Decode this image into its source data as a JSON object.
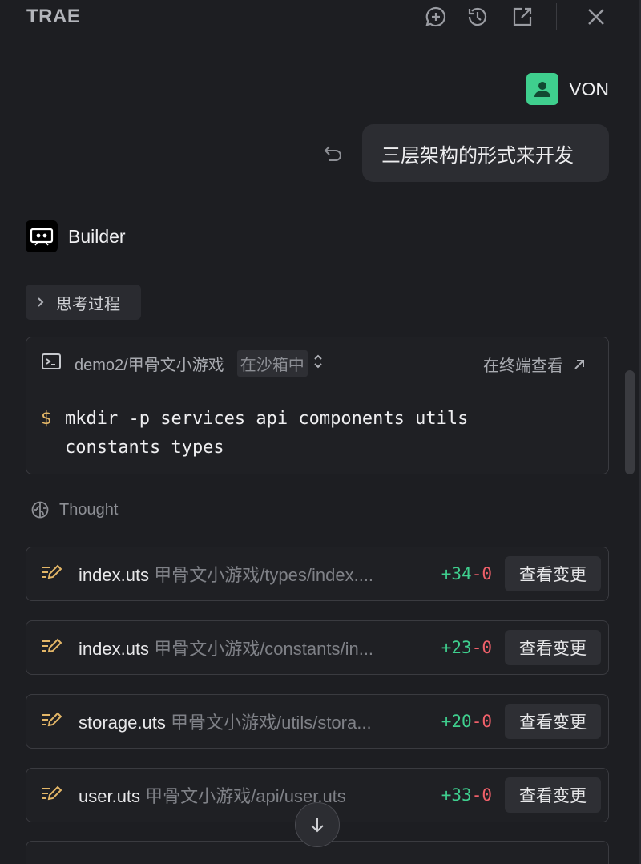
{
  "header": {
    "title": "TRAE",
    "icons": [
      "chat-add-icon",
      "history-icon",
      "external-window-icon",
      "close-icon"
    ]
  },
  "user": {
    "name": "VON",
    "avatar_color": "#3fcf8e"
  },
  "user_message": {
    "text": "三层架构的形式来开发"
  },
  "assistant": {
    "name": "Builder"
  },
  "thinking": {
    "label": "思考过程"
  },
  "terminal": {
    "path": "demo2/甲骨文小游戏",
    "sandbox": "在沙箱中",
    "view_label": "在终端查看",
    "prompt": "$",
    "command_line1": "mkdir -p services api components utils",
    "command_line2": "constants types"
  },
  "thought": {
    "label": "Thought"
  },
  "files": [
    {
      "name": "index.uts",
      "path": "甲骨文小游戏/types/index....",
      "added": "+34",
      "removed": "-0",
      "button": "查看变更"
    },
    {
      "name": "index.uts",
      "path": "甲骨文小游戏/constants/in...",
      "added": "+23",
      "removed": "-0",
      "button": "查看变更"
    },
    {
      "name": "storage.uts",
      "path": "甲骨文小游戏/utils/stora...",
      "added": "+20",
      "removed": "-0",
      "button": "查看变更"
    },
    {
      "name": "user.uts",
      "path": "甲骨文小游戏/api/user.uts",
      "added": "+33",
      "removed": "-0",
      "button": "查看变更"
    }
  ],
  "colors": {
    "background": "#1d1e22",
    "accent_green": "#3fcf8e",
    "removed_red": "#f0606a",
    "prompt_yellow": "#e3b667"
  }
}
